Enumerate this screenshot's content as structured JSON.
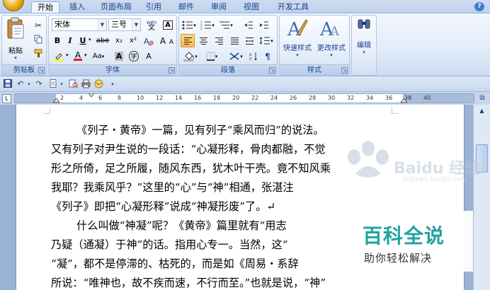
{
  "tabs": [
    "开始",
    "插入",
    "页面布局",
    "引用",
    "邮件",
    "审阅",
    "视图",
    "开发工具"
  ],
  "clipboard": {
    "paste_label": "粘贴",
    "group_label": "剪贴板"
  },
  "font": {
    "font_name": "宋体",
    "font_size": "三号",
    "group_label": "字体",
    "wen_label": "wén",
    "bold": "B",
    "italic": "I",
    "underline": "U",
    "strike": "abe",
    "subscript": "x₂",
    "superscript": "x²",
    "font_color": "A",
    "size_case": "Aa",
    "char_shade": "A",
    "enclose": "字",
    "char_border": "A",
    "grow": "A",
    "shrink": "A"
  },
  "paragraph": {
    "group_label": "段落"
  },
  "styles": {
    "quick_label": "快速样式",
    "change_label": "更改样式",
    "group_label": "样式"
  },
  "editing": {
    "label": "编辑"
  },
  "ruler": {
    "tab_selector": "L",
    "numbers": [
      "2",
      "4",
      "6",
      "8",
      "10",
      "12",
      "14",
      "16",
      "18",
      "20",
      "22",
      "24",
      "26",
      "28",
      "30",
      "32",
      "34",
      "36",
      "38",
      "40"
    ]
  },
  "document": {
    "lines": [
      "《列子・黄帝》一篇，见有列子“乘风而归”的说法。",
      "又有列子对尹生说的一段话：“心凝形释，骨肉都融，不觉",
      "形之所倚，足之所履，随风东西，犹木叶干壳。竟不知风乘",
      "我耶？我乘风乎？”这里的“心”与“神”相通，张湛注",
      "《列子》即把“心凝形释”说成“神凝形废”了。↵",
      "什么叫做“神凝”呢？《黄帝》篇里就有“用志",
      "乃疑（通凝）于神”的话。指用心专一。当然，这“",
      "“凝”，都不是停滞的、枯死的，而是如《周易・系辞",
      "所说：“唯神也，故不疾而速，不行而至。”也就是说，“神”"
    ]
  },
  "watermark": {
    "baidu_text": "Baidu 经验",
    "baidu_url": "jingyan.baidu.com",
    "title": "百科全说",
    "subtitle": "助你轻松解决"
  }
}
